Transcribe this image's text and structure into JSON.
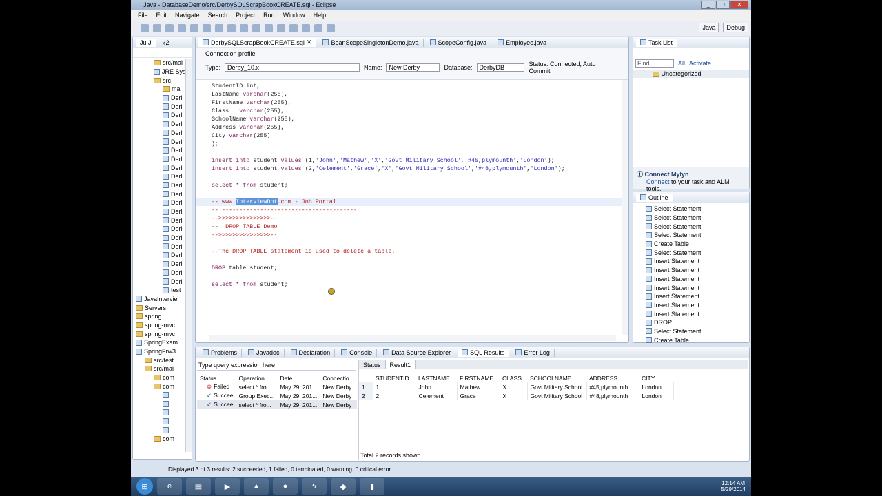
{
  "window": {
    "title": "Java - DatabaseDemo/src/DerbySQLScrapBookCREATE.sql - Eclipse"
  },
  "menu": [
    "File",
    "Edit",
    "Navigate",
    "Search",
    "Project",
    "Run",
    "Window",
    "Help"
  ],
  "perspectives": [
    "Java",
    "Debug"
  ],
  "left_pane": {
    "tabs": [
      "Ju J",
      "»2"
    ],
    "items": [
      {
        "label": "src/mai",
        "icon": "source-folder",
        "indent": 2
      },
      {
        "label": "JRE Syst",
        "icon": "library",
        "indent": 2
      },
      {
        "label": "src",
        "icon": "folder",
        "indent": 2
      },
      {
        "label": "mai",
        "icon": "folder",
        "indent": 3
      },
      {
        "label": "Derl",
        "icon": "sql-file",
        "indent": 3
      },
      {
        "label": "Derl",
        "icon": "sql-file",
        "indent": 3
      },
      {
        "label": "Derl",
        "icon": "sql-file",
        "indent": 3
      },
      {
        "label": "Derl",
        "icon": "sql-file",
        "indent": 3
      },
      {
        "label": "Derl",
        "icon": "sql-file",
        "indent": 3
      },
      {
        "label": "Derl",
        "icon": "sql-file",
        "indent": 3
      },
      {
        "label": "Derl",
        "icon": "sql-file",
        "indent": 3
      },
      {
        "label": "Derl",
        "icon": "sql-file",
        "indent": 3
      },
      {
        "label": "Derl",
        "icon": "sql-file",
        "indent": 3
      },
      {
        "label": "Derl",
        "icon": "sql-file",
        "indent": 3
      },
      {
        "label": "Derl",
        "icon": "sql-file",
        "indent": 3
      },
      {
        "label": "Derl",
        "icon": "sql-file",
        "indent": 3
      },
      {
        "label": "Derl",
        "icon": "sql-file",
        "indent": 3
      },
      {
        "label": "Derl",
        "icon": "sql-file",
        "indent": 3
      },
      {
        "label": "Derl",
        "icon": "sql-file",
        "indent": 3
      },
      {
        "label": "Derl",
        "icon": "sql-file",
        "indent": 3
      },
      {
        "label": "Derl",
        "icon": "sql-file",
        "indent": 3
      },
      {
        "label": "Derl",
        "icon": "sql-file",
        "indent": 3
      },
      {
        "label": "Derl",
        "icon": "sql-file",
        "indent": 3
      },
      {
        "label": "Derl",
        "icon": "sql-file",
        "indent": 3
      },
      {
        "label": "Derl",
        "icon": "sql-file",
        "indent": 3
      },
      {
        "label": "Derl",
        "icon": "sql-file",
        "indent": 3
      },
      {
        "label": "test",
        "icon": "sql-file",
        "indent": 3
      },
      {
        "label": "JavaIntervie",
        "icon": "project",
        "indent": 0
      },
      {
        "label": "Servers",
        "icon": "folder",
        "indent": 0
      },
      {
        "label": "spring",
        "icon": "folder",
        "indent": 0
      },
      {
        "label": "spring-mvc",
        "icon": "folder",
        "indent": 0
      },
      {
        "label": "spring-mvc",
        "icon": "folder",
        "indent": 0
      },
      {
        "label": "SpringExam",
        "icon": "project",
        "indent": 0
      },
      {
        "label": "SpringFrw3",
        "icon": "project",
        "indent": 0
      },
      {
        "label": "src/test",
        "icon": "source-folder",
        "indent": 1
      },
      {
        "label": "src/mai",
        "icon": "source-folder",
        "indent": 1
      },
      {
        "label": "com",
        "icon": "package",
        "indent": 2
      },
      {
        "label": "com",
        "icon": "package",
        "indent": 2
      },
      {
        "label": "",
        "icon": "java-file",
        "indent": 3
      },
      {
        "label": "",
        "icon": "java-file",
        "indent": 3
      },
      {
        "label": "",
        "icon": "java-file",
        "indent": 3
      },
      {
        "label": "",
        "icon": "java-file",
        "indent": 3
      },
      {
        "label": "",
        "icon": "java-file",
        "indent": 3
      },
      {
        "label": "com",
        "icon": "package",
        "indent": 2
      }
    ]
  },
  "editor": {
    "tabs": [
      {
        "label": "DerbySQLScrapBookCREATE.sql",
        "active": true
      },
      {
        "label": "BeanScopeSingletonDemo.java"
      },
      {
        "label": "ScopeConfig.java"
      },
      {
        "label": "Employee.java"
      }
    ],
    "connection_profile": "Connection profile",
    "type_label": "Type:",
    "type_value": "Derby_10.x",
    "name_label": "Name:",
    "name_value": "New Derby",
    "database_label": "Database:",
    "database_value": "DerbyDB",
    "status": "Status: Connected, Auto Commit",
    "lines": [
      [
        [
          "plain",
          "StudentID int,"
        ]
      ],
      [
        [
          "plain",
          "LastName "
        ],
        [
          "kw",
          "varchar"
        ],
        [
          "plain",
          "(255),"
        ]
      ],
      [
        [
          "plain",
          "FirstName "
        ],
        [
          "kw",
          "varchar"
        ],
        [
          "plain",
          "(255),"
        ]
      ],
      [
        [
          "plain",
          "Class   "
        ],
        [
          "kw",
          "varchar"
        ],
        [
          "plain",
          "(255),"
        ]
      ],
      [
        [
          "plain",
          "SchoolName "
        ],
        [
          "kw",
          "varchar"
        ],
        [
          "plain",
          "(255),"
        ]
      ],
      [
        [
          "plain",
          "Address "
        ],
        [
          "kw",
          "varchar"
        ],
        [
          "plain",
          "(255),"
        ]
      ],
      [
        [
          "plain",
          "City "
        ],
        [
          "kw",
          "varchar"
        ],
        [
          "plain",
          "(255)"
        ]
      ],
      [
        [
          "plain",
          ");"
        ]
      ],
      [],
      [
        [
          "kw",
          "insert into "
        ],
        [
          "plain",
          "student "
        ],
        [
          "kw",
          "values "
        ],
        [
          "plain",
          "(1,"
        ],
        [
          "str",
          "'John'"
        ],
        [
          "plain",
          ","
        ],
        [
          "str",
          "'Mathew'"
        ],
        [
          "plain",
          ","
        ],
        [
          "str",
          "'X'"
        ],
        [
          "plain",
          ","
        ],
        [
          "str",
          "'Govt Military School'"
        ],
        [
          "plain",
          ","
        ],
        [
          "str",
          "'#45,plymounth'"
        ],
        [
          "plain",
          ","
        ],
        [
          "str",
          "'London'"
        ],
        [
          "plain",
          ");"
        ]
      ],
      [
        [
          "kw",
          "insert into "
        ],
        [
          "plain",
          "student "
        ],
        [
          "kw",
          "values "
        ],
        [
          "plain",
          "(2,"
        ],
        [
          "str",
          "'Celement'"
        ],
        [
          "plain",
          ","
        ],
        [
          "str",
          "'Grace'"
        ],
        [
          "plain",
          ","
        ],
        [
          "str",
          "'X'"
        ],
        [
          "plain",
          ","
        ],
        [
          "str",
          "'Govt Military School'"
        ],
        [
          "plain",
          ","
        ],
        [
          "str",
          "'#48,plymounth'"
        ],
        [
          "plain",
          ","
        ],
        [
          "str",
          "'London'"
        ],
        [
          "plain",
          ");"
        ]
      ],
      [],
      [
        [
          "kw",
          "select "
        ],
        [
          "plain",
          "* "
        ],
        [
          "kw",
          "from "
        ],
        [
          "plain",
          "student;"
        ]
      ],
      [],
      [
        [
          "cmt",
          "-- www."
        ],
        [
          "hl",
          "InterviewDot"
        ],
        [
          "cmt",
          ".com - Job Portal"
        ]
      ],
      [
        [
          "cmt",
          "-- ---------------------------------------"
        ]
      ],
      [
        [
          "cmt",
          "-->>>>>>>>>>>>>>>--"
        ]
      ],
      [
        [
          "cmt",
          "--  DROP TABLE Demo"
        ]
      ],
      [
        [
          "cmt",
          "-->>>>>>>>>>>>>>>--"
        ]
      ],
      [],
      [
        [
          "cmt",
          "--The DROP TABLE statement is used to delete a table."
        ]
      ],
      [],
      [
        [
          "kw",
          "DROP "
        ],
        [
          "plain",
          "table student;"
        ]
      ],
      [],
      [
        [
          "kw",
          "select "
        ],
        [
          "plain",
          "* "
        ],
        [
          "kw",
          "from "
        ],
        [
          "plain",
          "student;"
        ]
      ]
    ]
  },
  "task_list": {
    "title": "Task List",
    "find_placeholder": "Find",
    "all": "All",
    "activate": "Activate...",
    "uncategorized": "Uncategorized",
    "mylyn_title": "Connect Mylyn",
    "mylyn_link": "Connect",
    "mylyn_text": " to your task and ALM tools."
  },
  "outline": {
    "title": "Outline",
    "items": [
      "Select Statement",
      "Select Statement",
      "Select Statement",
      "Select Statement",
      "Create Table",
      "Select Statement",
      "Insert Statement",
      "Insert Statement",
      "Insert Statement",
      "Insert Statement",
      "Insert Statement",
      "Insert Statement",
      "Insert Statement",
      "DROP",
      "Select Statement",
      "Create Table"
    ]
  },
  "bottom": {
    "tabs": [
      "Problems",
      "Javadoc",
      "Declaration",
      "Console",
      "Data Source Explorer",
      "SQL Results",
      "Error Log"
    ],
    "query_placeholder": "Type query expression here",
    "history_headers": [
      "Status",
      "Operation",
      "Date",
      "Connectio..."
    ],
    "history": [
      {
        "status": "Failed",
        "operation": "select * fro...",
        "date": "May 29, 201...",
        "connection": "New Derby",
        "ok": false
      },
      {
        "status": "Succee",
        "operation": "Group Exec...",
        "date": "May 29, 201...",
        "connection": "New Derby",
        "ok": true
      },
      {
        "status": "Succee",
        "operation": "select * fro...",
        "date": "May 29, 201...",
        "connection": "New Derby",
        "ok": true
      }
    ],
    "result_tabs": [
      "Status",
      "Result1"
    ],
    "result_headers": [
      "",
      "STUDENTID",
      "LASTNAME",
      "FIRSTNAME",
      "CLASS",
      "SCHOOLNAME",
      "ADDRESS",
      "CITY"
    ],
    "result_rows": [
      [
        "1",
        "1",
        "John",
        "Mathew",
        "X",
        "Govt Military School",
        "#45,plymounth",
        "London"
      ],
      [
        "2",
        "2",
        "Celement",
        "Grace",
        "X",
        "Govt Military School",
        "#48,plymounth",
        "London"
      ]
    ],
    "records": "Total 2 records shown"
  },
  "statusbar": "Displayed 3 of 3 results: 2 succeeded, 1 failed, 0 terminated, 0 warning, 0 critical error",
  "clock": {
    "time": "12:14 AM",
    "date": "5/29/2014"
  }
}
